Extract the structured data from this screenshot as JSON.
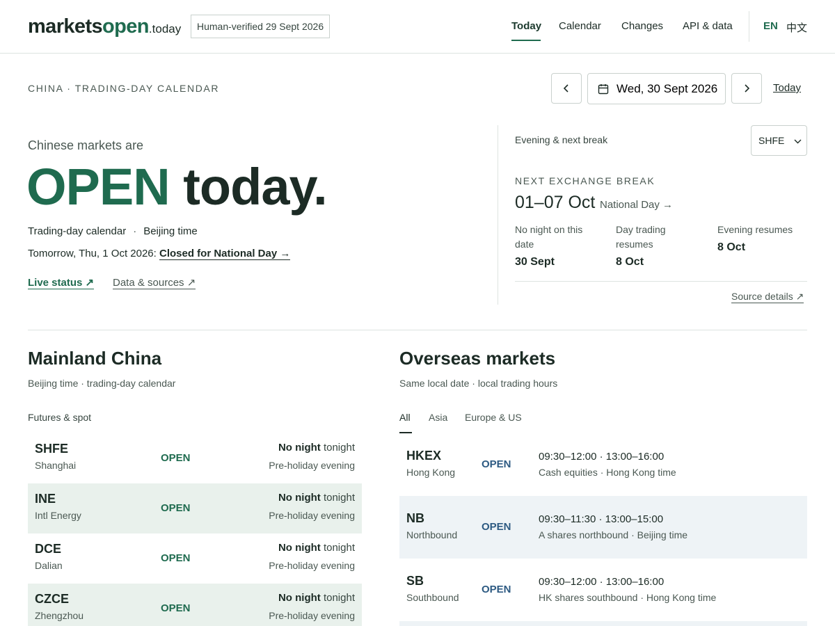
{
  "header": {
    "logo": {
      "markets": "markets",
      "open": "open",
      "tld": ".today"
    },
    "verified_badge": "Human-verified 29 Sept 2026",
    "nav": [
      {
        "label": "Today"
      },
      {
        "label": "Calendar"
      },
      {
        "label": "Changes"
      },
      {
        "label": "API & data"
      }
    ],
    "lang": [
      {
        "label": "EN"
      },
      {
        "label": "中文"
      }
    ]
  },
  "toolbar": {
    "eyebrow": "CHINA · TRADING-DAY CALENDAR",
    "date": "Wed, 30 Sept 2026",
    "today_label": "Today"
  },
  "hero": {
    "intro": "Chinese markets are",
    "status": "OPEN",
    "today": "today.",
    "meta1": "Trading-day calendar",
    "meta_sep": "·",
    "meta2": "Beijing time",
    "tomorrow_prefix": "Tomorrow, Thu, 1 Oct 2026:",
    "tomorrow_link": "Closed for National Day →",
    "live_status": "Live status ↗",
    "data_sources": "Data & sources ↗"
  },
  "panel": {
    "label": "Evening & next break",
    "select_value": "SHFE",
    "eyebrow": "NEXT EXCHANGE BREAK",
    "range": "01–07 Oct",
    "holiday": "National Day →",
    "cells": [
      {
        "label": "No night on this date",
        "value": "30 Sept"
      },
      {
        "label": "Day trading resumes",
        "value": "8 Oct"
      },
      {
        "label": "Evening resumes",
        "value": "8 Oct"
      }
    ],
    "source_details": "Source details ↗"
  },
  "mainland": {
    "title": "Mainland China",
    "subtitle": "Beijing time · trading-day calendar",
    "group_label": "Futures & spot",
    "rows": [
      {
        "code": "SHFE",
        "city": "Shanghai",
        "status": "OPEN",
        "night_bold": "No night",
        "night_rest": "tonight",
        "session": "Pre-holiday evening"
      },
      {
        "code": "INE",
        "city": "Intl Energy",
        "status": "OPEN",
        "night_bold": "No night",
        "night_rest": "tonight",
        "session": "Pre-holiday evening"
      },
      {
        "code": "DCE",
        "city": "Dalian",
        "status": "OPEN",
        "night_bold": "No night",
        "night_rest": "tonight",
        "session": "Pre-holiday evening"
      },
      {
        "code": "CZCE",
        "city": "Zhengzhou",
        "status": "OPEN",
        "night_bold": "No night",
        "night_rest": "tonight",
        "session": "Pre-holiday evening"
      }
    ]
  },
  "overseas": {
    "title": "Overseas markets",
    "subtitle": "Same local date · local trading hours",
    "tabs": [
      {
        "label": "All"
      },
      {
        "label": "Asia"
      },
      {
        "label": "Europe & US"
      }
    ],
    "rows": [
      {
        "code": "HKEX",
        "city": "Hong Kong",
        "status": "OPEN",
        "hours": "09:30–12:00 · 13:00–16:00",
        "desc": "Cash equities · Hong Kong time"
      },
      {
        "code": "NB",
        "city": "Northbound",
        "status": "OPEN",
        "hours": "09:30–11:30 · 13:00–15:00",
        "desc": "A shares northbound · Beijing time"
      },
      {
        "code": "SB",
        "city": "Southbound",
        "status": "OPEN",
        "hours": "09:30–12:00 · 13:00–16:00",
        "desc": "HK shares southbound · Hong Kong time"
      }
    ]
  },
  "colors": {
    "brand_green": "#1f6b4f",
    "text_dark": "#1c2b25",
    "row_shade_green": "#e9f1ec",
    "row_shade_blue": "#eef3f6",
    "status_blue": "#2d5a82"
  }
}
